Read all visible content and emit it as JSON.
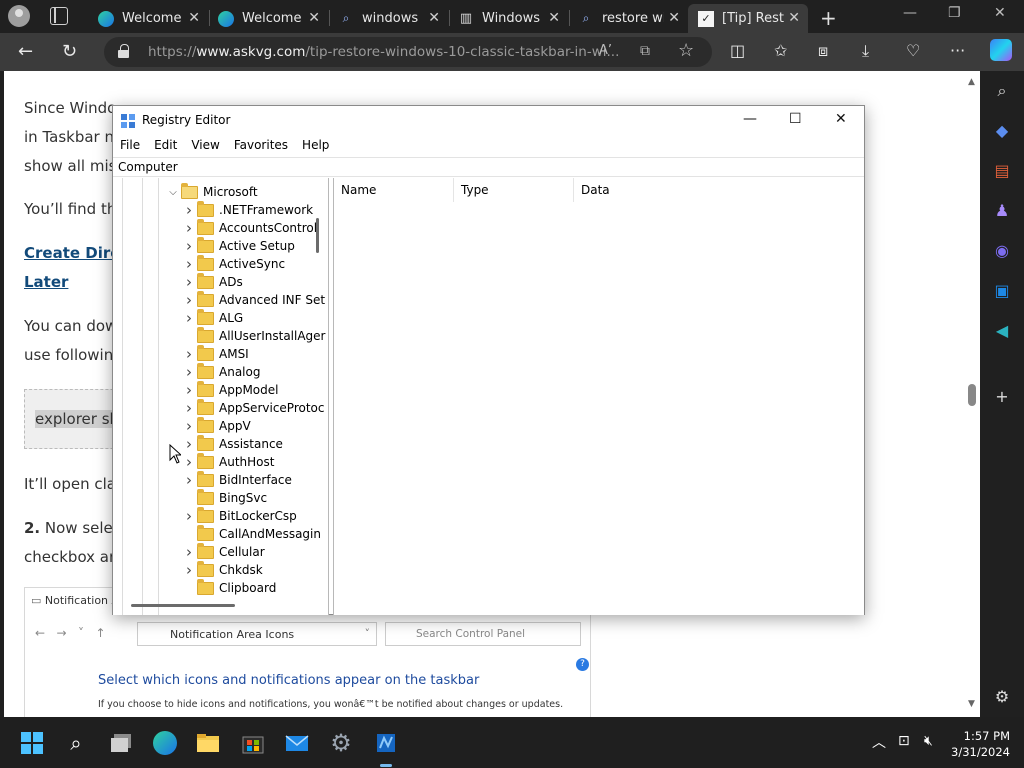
{
  "browser": {
    "tabs": [
      {
        "title": "Welcome",
        "icon": "edge-icon"
      },
      {
        "title": "Welcome",
        "icon": "edge-icon"
      },
      {
        "title": "windows",
        "icon": "search-icon"
      },
      {
        "title": "Windows",
        "icon": "store-icon"
      },
      {
        "title": "restore wi",
        "icon": "search-icon"
      },
      {
        "title": "[Tip] Resto",
        "icon": "askvg-icon"
      }
    ],
    "url": {
      "prefix": "https://",
      "domain": "www.askvg.com",
      "path": "/tip-restore-windows-10-classic-taskbar-in-wi..."
    },
    "read_aloud_label": "A’"
  },
  "article": {
    "p1_line1": "Since Windo",
    "p1_line2": "in Taskbar no",
    "p1_line3": "show all miss",
    "p2": "You’ll find th",
    "link_line1": "Create Direc",
    "link_line2": "Later",
    "p3_line1": "You can dow",
    "p3_line2": "use following",
    "code": "explorer sh",
    "p4": "It’ll open clas",
    "step_number": "2.",
    "p5_line1": " Now selec",
    "p5_line2": "checkbox an"
  },
  "screenshot": {
    "window_title": "Notification Ar",
    "address": "Notification Area Icons",
    "search_placeholder": "Search Control Panel",
    "heading": "Select which icons and notifications appear on the taskbar",
    "description": "If you choose to hide icons and notifications, you wonâ€™t be notified about changes or updates.",
    "help": "?"
  },
  "regedit": {
    "title": "Registry Editor",
    "menu": [
      "File",
      "Edit",
      "View",
      "Favorites",
      "Help"
    ],
    "path": "Computer",
    "tree": {
      "parent": "Microsoft",
      "children": [
        {
          "name": ".NETFramework",
          "expandable": true
        },
        {
          "name": "AccountsControl",
          "expandable": true
        },
        {
          "name": "Active Setup",
          "expandable": true
        },
        {
          "name": "ActiveSync",
          "expandable": true
        },
        {
          "name": "ADs",
          "expandable": true
        },
        {
          "name": "Advanced INF Set",
          "expandable": true
        },
        {
          "name": "ALG",
          "expandable": true
        },
        {
          "name": "AllUserInstallAger",
          "expandable": false
        },
        {
          "name": "AMSI",
          "expandable": true
        },
        {
          "name": "Analog",
          "expandable": true
        },
        {
          "name": "AppModel",
          "expandable": true
        },
        {
          "name": "AppServiceProtoc",
          "expandable": true
        },
        {
          "name": "AppV",
          "expandable": true
        },
        {
          "name": "Assistance",
          "expandable": true
        },
        {
          "name": "AuthHost",
          "expandable": true
        },
        {
          "name": "BidInterface",
          "expandable": true
        },
        {
          "name": "BingSvc",
          "expandable": false
        },
        {
          "name": "BitLockerCsp",
          "expandable": true
        },
        {
          "name": "CallAndMessagin",
          "expandable": false
        },
        {
          "name": "Cellular",
          "expandable": true
        },
        {
          "name": "Chkdsk",
          "expandable": true
        },
        {
          "name": "Clipboard",
          "expandable": false
        }
      ]
    },
    "columns": [
      "Name",
      "Type",
      "Data"
    ]
  },
  "taskbar": {
    "time": "1:57 PM",
    "date": "3/31/2024"
  },
  "colors": {
    "accent": "#76b9ed",
    "link": "#124a7a",
    "folder": "#f2c94c"
  }
}
